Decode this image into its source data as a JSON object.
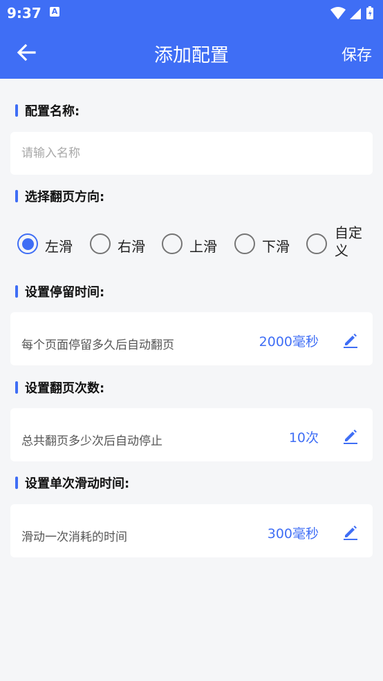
{
  "status": {
    "time": "9:37",
    "notification_icon": "A"
  },
  "header": {
    "title": "添加配置",
    "save_label": "保存"
  },
  "config_name": {
    "label": "配置名称:",
    "placeholder": "请输入名称",
    "value": ""
  },
  "direction": {
    "label": "选择翻页方向:",
    "options": [
      {
        "label": "左滑",
        "checked": true
      },
      {
        "label": "右滑",
        "checked": false
      },
      {
        "label": "上滑",
        "checked": false
      },
      {
        "label": "下滑",
        "checked": false
      },
      {
        "label": "自定义",
        "checked": false
      }
    ]
  },
  "stay_time": {
    "label": "设置停留时间:",
    "desc": "每个页面停留多久后自动翻页",
    "value": "2000毫秒"
  },
  "page_count": {
    "label": "设置翻页次数:",
    "desc": "总共翻页多少次后自动停止",
    "value": "10次"
  },
  "swipe_time": {
    "label": "设置单次滑动时间:",
    "desc": "滑动一次消耗的时间",
    "value": "300毫秒"
  },
  "colors": {
    "primary": "#3f6ef5",
    "background": "#f5f6f8"
  }
}
